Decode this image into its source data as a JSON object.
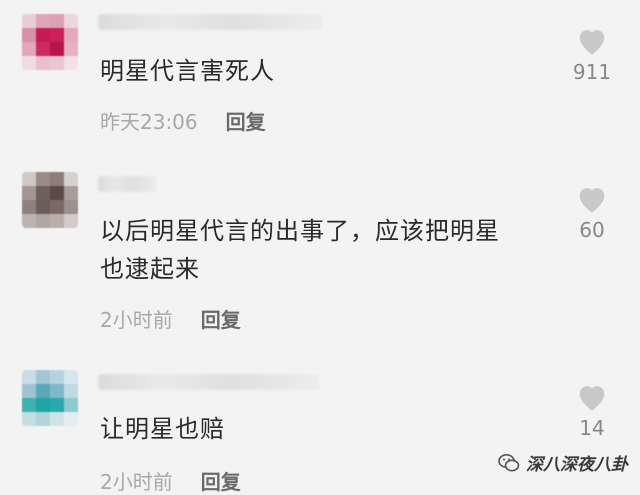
{
  "comments": [
    {
      "text": "明星代言害死人",
      "time": "昨天23:06",
      "reply": "回复",
      "likes": "911"
    },
    {
      "text": "以后明星代言的出事了，应该把明星\n也逮起来",
      "time": "2小时前",
      "reply": "回复",
      "likes": "60"
    },
    {
      "text": "让明星也赔",
      "time": "2小时前",
      "reply": "回复",
      "likes": "14"
    }
  ],
  "watermark": "深八深夜八卦",
  "colors": {
    "heart": "#c8c8c8",
    "background": "#f3f3f3"
  }
}
